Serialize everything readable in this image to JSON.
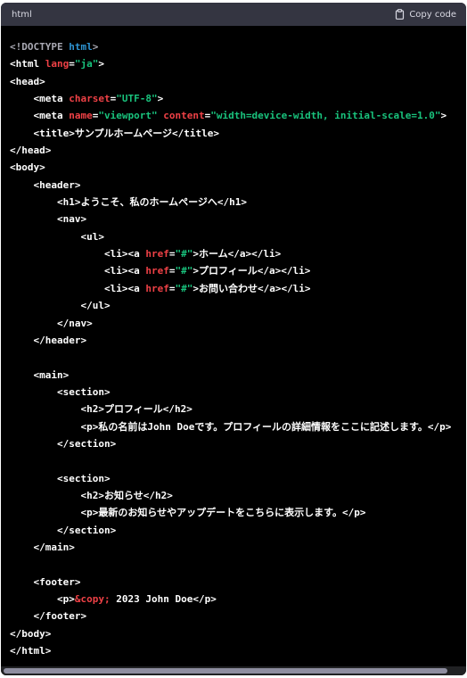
{
  "header": {
    "language": "html",
    "copy_label": "Copy code"
  },
  "code_lines": [
    [
      {
        "c": "punc",
        "t": "<!DOCTYPE "
      },
      {
        "c": "doctype",
        "t": "html"
      },
      {
        "c": "punc",
        "t": ">"
      }
    ],
    [
      {
        "c": "tag",
        "t": "<html "
      },
      {
        "c": "attr",
        "t": "lang"
      },
      {
        "c": "tag",
        "t": "="
      },
      {
        "c": "str",
        "t": "\"ja\""
      },
      {
        "c": "tag",
        "t": ">"
      }
    ],
    [
      {
        "c": "tag",
        "t": "<head>"
      }
    ],
    [
      {
        "c": "tag",
        "t": "    <meta "
      },
      {
        "c": "attr",
        "t": "charset"
      },
      {
        "c": "tag",
        "t": "="
      },
      {
        "c": "str",
        "t": "\"UTF-8\""
      },
      {
        "c": "tag",
        "t": ">"
      }
    ],
    [
      {
        "c": "tag",
        "t": "    <meta "
      },
      {
        "c": "attr",
        "t": "name"
      },
      {
        "c": "tag",
        "t": "="
      },
      {
        "c": "str",
        "t": "\"viewport\""
      },
      {
        "c": "tag",
        "t": " "
      },
      {
        "c": "attr",
        "t": "content"
      },
      {
        "c": "tag",
        "t": "="
      },
      {
        "c": "str",
        "t": "\"width=device-width, initial-scale=1.0\""
      },
      {
        "c": "tag",
        "t": ">"
      }
    ],
    [
      {
        "c": "tag",
        "t": "    <title>サンプルホームページ</title>"
      }
    ],
    [
      {
        "c": "tag",
        "t": "</head>"
      }
    ],
    [
      {
        "c": "tag",
        "t": "<body>"
      }
    ],
    [
      {
        "c": "tag",
        "t": "    <header>"
      }
    ],
    [
      {
        "c": "tag",
        "t": "        <h1>ようこそ、私のホームページへ</h1>"
      }
    ],
    [
      {
        "c": "tag",
        "t": "        <nav>"
      }
    ],
    [
      {
        "c": "tag",
        "t": "            <ul>"
      }
    ],
    [
      {
        "c": "tag",
        "t": "                <li><a "
      },
      {
        "c": "attr",
        "t": "href"
      },
      {
        "c": "tag",
        "t": "="
      },
      {
        "c": "str",
        "t": "\"#\""
      },
      {
        "c": "tag",
        "t": ">ホーム</a></li>"
      }
    ],
    [
      {
        "c": "tag",
        "t": "                <li><a "
      },
      {
        "c": "attr",
        "t": "href"
      },
      {
        "c": "tag",
        "t": "="
      },
      {
        "c": "str",
        "t": "\"#\""
      },
      {
        "c": "tag",
        "t": ">プロフィール</a></li>"
      }
    ],
    [
      {
        "c": "tag",
        "t": "                <li><a "
      },
      {
        "c": "attr",
        "t": "href"
      },
      {
        "c": "tag",
        "t": "="
      },
      {
        "c": "str",
        "t": "\"#\""
      },
      {
        "c": "tag",
        "t": ">お問い合わせ</a></li>"
      }
    ],
    [
      {
        "c": "tag",
        "t": "            </ul>"
      }
    ],
    [
      {
        "c": "tag",
        "t": "        </nav>"
      }
    ],
    [
      {
        "c": "tag",
        "t": "    </header>"
      }
    ],
    [
      {
        "c": "tag",
        "t": ""
      }
    ],
    [
      {
        "c": "tag",
        "t": "    <main>"
      }
    ],
    [
      {
        "c": "tag",
        "t": "        <section>"
      }
    ],
    [
      {
        "c": "tag",
        "t": "            <h2>プロフィール</h2>"
      }
    ],
    [
      {
        "c": "tag",
        "t": "            <p>私の名前はJohn Doeです。プロフィールの詳細情報をここに記述します。</p>"
      }
    ],
    [
      {
        "c": "tag",
        "t": "        </section>"
      }
    ],
    [
      {
        "c": "tag",
        "t": ""
      }
    ],
    [
      {
        "c": "tag",
        "t": "        <section>"
      }
    ],
    [
      {
        "c": "tag",
        "t": "            <h2>お知らせ</h2>"
      }
    ],
    [
      {
        "c": "tag",
        "t": "            <p>最新のお知らせやアップデートをこちらに表示します。</p>"
      }
    ],
    [
      {
        "c": "tag",
        "t": "        </section>"
      }
    ],
    [
      {
        "c": "tag",
        "t": "    </main>"
      }
    ],
    [
      {
        "c": "tag",
        "t": ""
      }
    ],
    [
      {
        "c": "tag",
        "t": "    <footer>"
      }
    ],
    [
      {
        "c": "tag",
        "t": "        <p>"
      },
      {
        "c": "ent",
        "t": "&copy;"
      },
      {
        "c": "tag",
        "t": " 2023 John Doe</p>"
      }
    ],
    [
      {
        "c": "tag",
        "t": "    </footer>"
      }
    ],
    [
      {
        "c": "tag",
        "t": "</body>"
      }
    ],
    [
      {
        "c": "tag",
        "t": "</html>"
      }
    ]
  ],
  "colors": {
    "background": "#000000",
    "header_bg": "#343541",
    "tag": "#ffffff",
    "attribute": "#ef4146",
    "string": "#19c37d",
    "doctype_keyword": "#2e95d3"
  },
  "icons": {
    "copy": "clipboard-icon"
  }
}
